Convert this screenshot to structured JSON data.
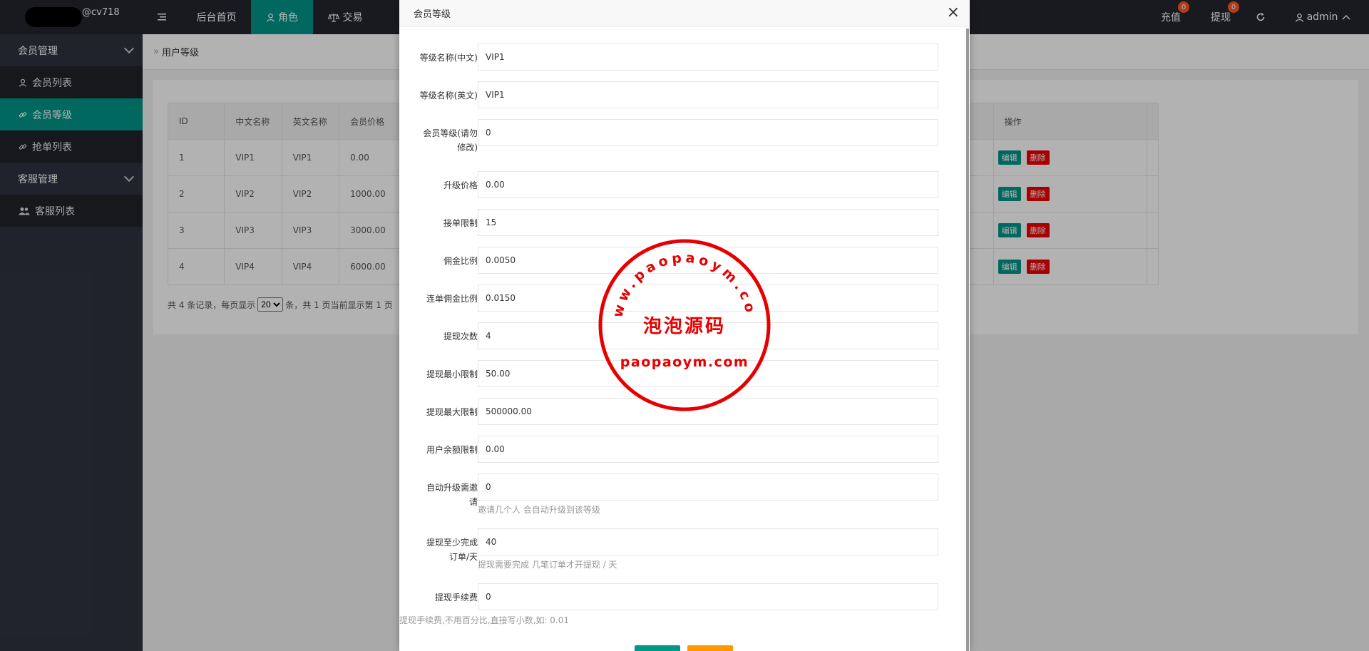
{
  "brand": {
    "suffix": "@cv718"
  },
  "sidebar": {
    "groups": [
      {
        "label": "会员管理",
        "items": [
          {
            "label": "会员列表",
            "icon": "user-icon"
          },
          {
            "label": "会员等级",
            "icon": "link-icon"
          },
          {
            "label": "抢单列表",
            "icon": "link-icon"
          }
        ]
      },
      {
        "label": "客服管理",
        "items": [
          {
            "label": "客服列表",
            "icon": "users-icon"
          }
        ]
      }
    ]
  },
  "header": {
    "nav": [
      {
        "label": "后台首页"
      },
      {
        "label": "角色"
      },
      {
        "label": "交易"
      }
    ],
    "recharge": {
      "label": "充值",
      "badge": "0"
    },
    "withdraw": {
      "label": "提现",
      "badge": "0"
    },
    "user": "admin"
  },
  "breadcrumb": "用户等级",
  "table": {
    "headers": [
      "ID",
      "中文名称",
      "英文名称",
      "会员价格",
      "操作"
    ],
    "rows": [
      {
        "id": "1",
        "cn": "VIP1",
        "en": "VIP1",
        "price": "0.00"
      },
      {
        "id": "2",
        "cn": "VIP2",
        "en": "VIP2",
        "price": "1000.00"
      },
      {
        "id": "3",
        "cn": "VIP3",
        "en": "VIP3",
        "price": "3000.00"
      },
      {
        "id": "4",
        "cn": "VIP4",
        "en": "VIP4",
        "price": "6000.00"
      }
    ],
    "edit_label": "编辑",
    "delete_label": "删除"
  },
  "pager": {
    "prefix": "共 4 条记录，每页显示",
    "per_page": "20",
    "suffix": "条，共 1 页当前显示第 1 页"
  },
  "modal": {
    "title": "会员等级",
    "close": "×",
    "fields": [
      {
        "label": "等级名称(中文)",
        "value": "VIP1",
        "required": false
      },
      {
        "label": "等级名称(英文)",
        "value": "VIP1",
        "required": false
      },
      {
        "label": "会员等级(请勿修改)",
        "value": "0",
        "required": true
      },
      {
        "label": "升级价格",
        "value": "0.00",
        "required": true
      },
      {
        "label": "接单限制",
        "value": "15",
        "required": true
      },
      {
        "label": "佣金比例",
        "value": "0.0050",
        "required": true
      },
      {
        "label": "连单佣金比例",
        "value": "0.0150",
        "required": true
      },
      {
        "label": "提现次数",
        "value": "4",
        "required": true
      },
      {
        "label": "提现最小限制",
        "value": "50.00",
        "required": true
      },
      {
        "label": "提现最大限制",
        "value": "500000.00",
        "required": true
      },
      {
        "label": "用户余额限制",
        "value": "0.00",
        "required": true
      },
      {
        "label": "自动升级需邀请",
        "value": "0",
        "required": true,
        "hint": "邀请几个人 会自动升级到该等级"
      },
      {
        "label": "提现至少完成订单/天",
        "value": "40",
        "required": true,
        "hint": "提现需要完成 几笔订单才开提现 / 天"
      },
      {
        "label": "提现手续费",
        "value": "0",
        "required": true,
        "hint": "提现手续费,不用百分比,直接写小数,如: 0.01"
      }
    ]
  },
  "watermark": {
    "top_arc": "www.paopaoym.com",
    "center": "泡泡源码",
    "bottom": "paopaoym.com",
    "color": "#e60000"
  },
  "colors": {
    "accent": "#009688",
    "danger": "#e00000",
    "badge": "#ff5722"
  }
}
